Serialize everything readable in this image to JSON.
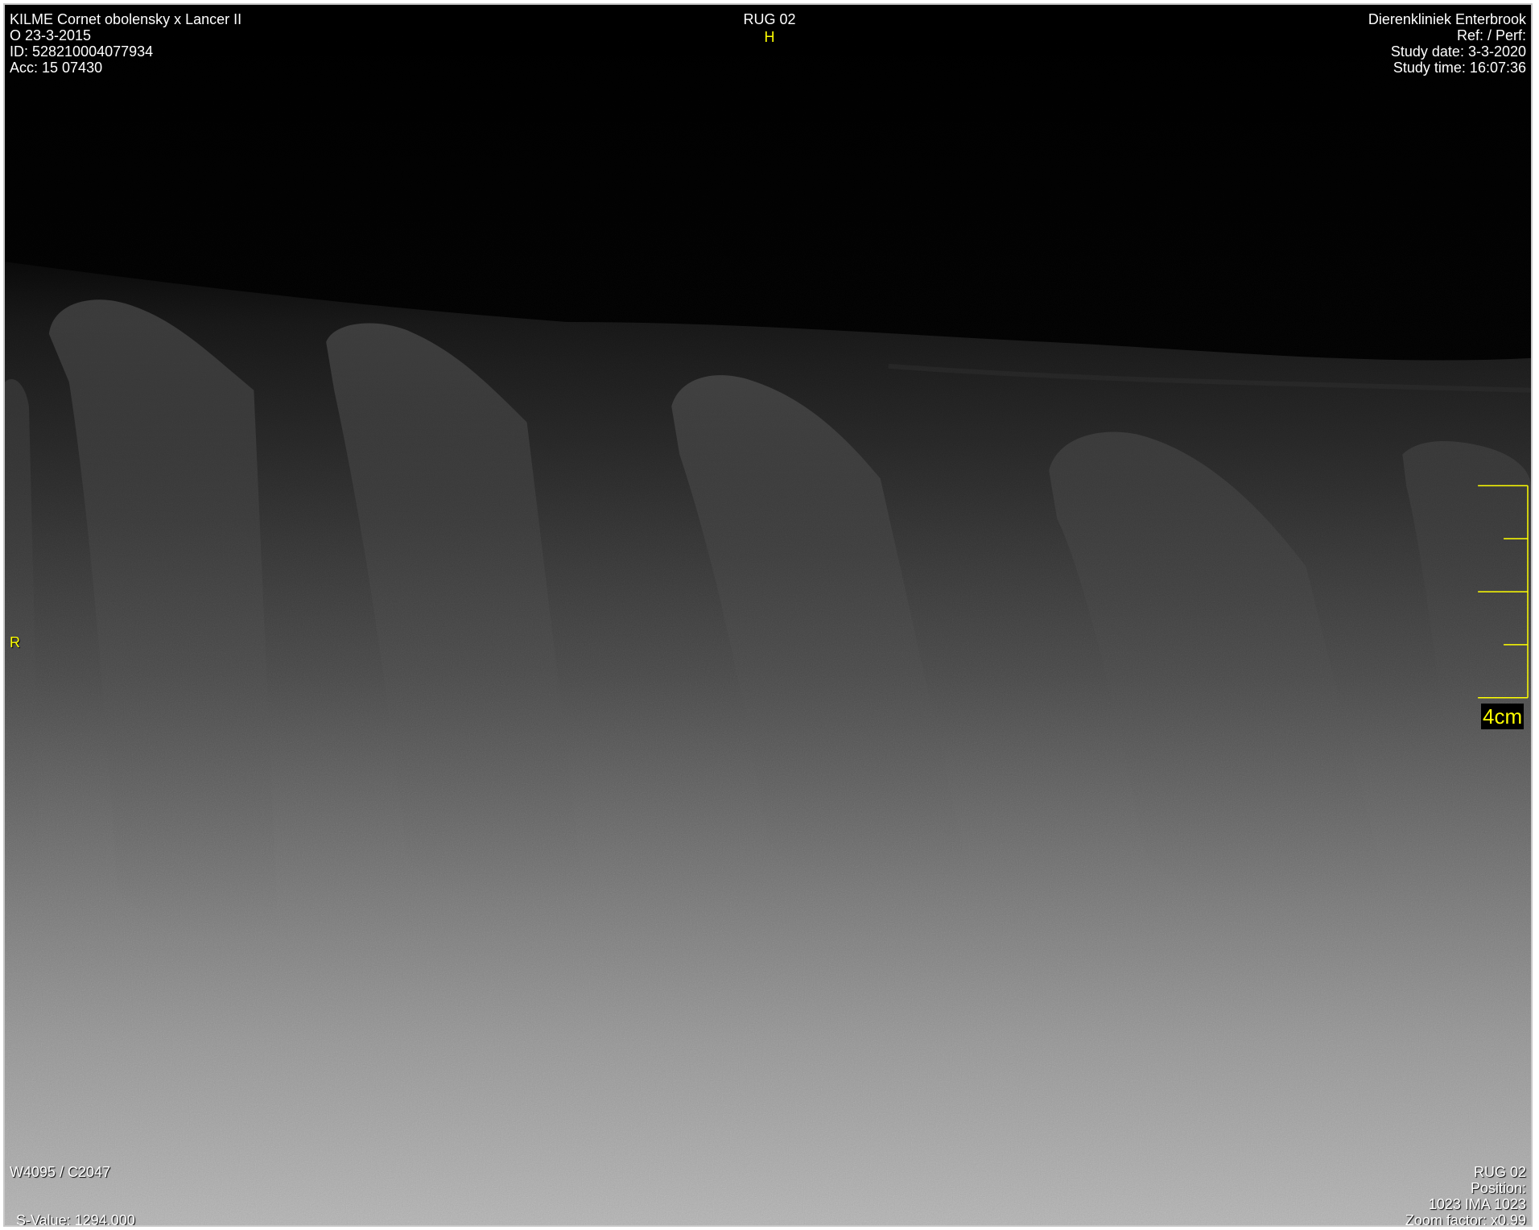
{
  "patient": {
    "name_line": "KILME  Cornet obolensky x Lancer II",
    "sex_birth": "O  23-3-2015",
    "id": "ID: 528210004077934",
    "acc": "Acc: 15 07430"
  },
  "series": {
    "title": "RUG 02"
  },
  "orientation": {
    "top": "H",
    "left": "R"
  },
  "institution": {
    "name": "Dierenkliniek Enterbrook",
    "ref_perf": "Ref:  / Perf:",
    "study_date": "Study date: 3-3-2020",
    "study_time": "Study time: 16:07:36"
  },
  "window": {
    "level": "W4095 / C2047",
    "s_value": "S-Value: 1294.000"
  },
  "image_info": {
    "series": "RUG 02",
    "position": "Position:",
    "image_index": "1023 IMA 1023",
    "zoom": "Zoom factor: x0.99"
  },
  "scale": {
    "label": "4cm",
    "color": "#ffff00"
  },
  "icons": [
    "scale-ruler-icon"
  ]
}
